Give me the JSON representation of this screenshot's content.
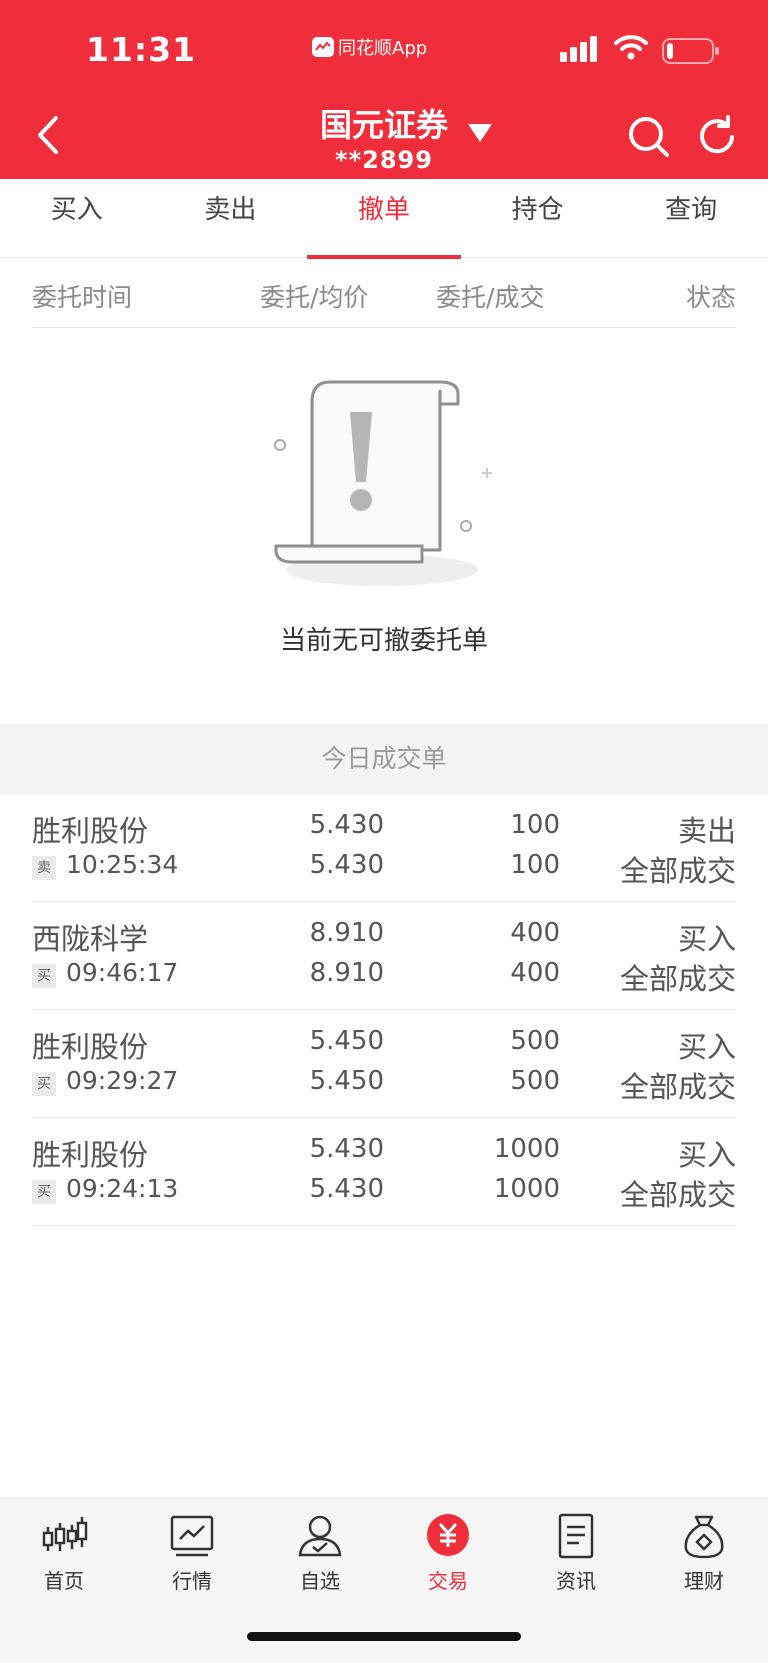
{
  "status_bar": {
    "time": "11:31",
    "app_name": "同花顺App"
  },
  "header": {
    "broker": "国元证券",
    "account": "**2899"
  },
  "tabs": [
    {
      "label": "买入"
    },
    {
      "label": "卖出"
    },
    {
      "label": "撤单"
    },
    {
      "label": "持仓"
    },
    {
      "label": "查询"
    }
  ],
  "active_tab": "撤单",
  "columns": [
    "委托时间",
    "委托/均价",
    "委托/成交",
    "状态"
  ],
  "empty_state": {
    "message": "当前无可撤委托单"
  },
  "today": {
    "title": "今日成交单",
    "rows": [
      {
        "name": "胜利股份",
        "badge": "卖",
        "time": "10:25:34",
        "price": "5.430",
        "avg_price": "5.430",
        "qty": "100",
        "filled": "100",
        "side": "卖出",
        "status": "全部成交"
      },
      {
        "name": "西陇科学",
        "badge": "买",
        "time": "09:46:17",
        "price": "8.910",
        "avg_price": "8.910",
        "qty": "400",
        "filled": "400",
        "side": "买入",
        "status": "全部成交"
      },
      {
        "name": "胜利股份",
        "badge": "买",
        "time": "09:29:27",
        "price": "5.450",
        "avg_price": "5.450",
        "qty": "500",
        "filled": "500",
        "side": "买入",
        "status": "全部成交"
      },
      {
        "name": "胜利股份",
        "badge": "买",
        "time": "09:24:13",
        "price": "5.430",
        "avg_price": "5.430",
        "qty": "1000",
        "filled": "1000",
        "side": "买入",
        "status": "全部成交"
      }
    ]
  },
  "bottom_nav": [
    {
      "label": "首页",
      "icon": "candlestick-icon"
    },
    {
      "label": "行情",
      "icon": "chart-monitor-icon"
    },
    {
      "label": "自选",
      "icon": "user-check-icon"
    },
    {
      "label": "交易",
      "icon": "yuan-coin-icon"
    },
    {
      "label": "资讯",
      "icon": "document-icon"
    },
    {
      "label": "理财",
      "icon": "money-bag-icon"
    }
  ],
  "colors": {
    "brand_red": "#f02d3a",
    "text_gray": "#555555",
    "header_gray": "#8a8a8a"
  }
}
